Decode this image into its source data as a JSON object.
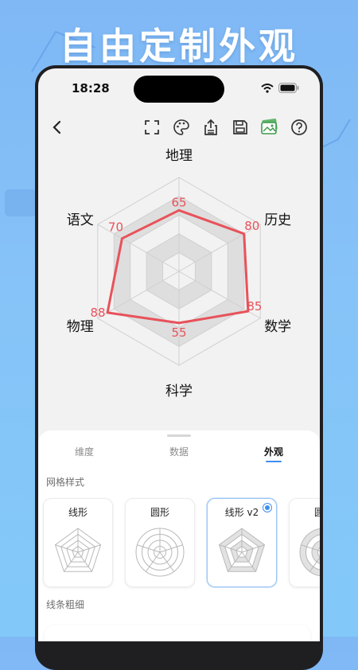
{
  "banner": {
    "title": "自由定制外观"
  },
  "status": {
    "time": "18:28"
  },
  "toolbar": {
    "icons": [
      "back-icon",
      "fullscreen-icon",
      "palette-icon",
      "export-icon",
      "save-icon",
      "image-icon",
      "help-icon"
    ]
  },
  "chart_data": {
    "type": "radar",
    "axes": [
      "地理",
      "历史",
      "数学",
      "科学",
      "物理",
      "语文"
    ],
    "values": [
      65,
      80,
      85,
      55,
      88,
      70
    ],
    "range": [
      0,
      100
    ],
    "series_color": "#e8525a"
  },
  "panel": {
    "tabs": [
      {
        "label": "维度"
      },
      {
        "label": "数据"
      },
      {
        "label": "外观"
      }
    ],
    "active_tab": "外观",
    "grid_style_title": "网格样式",
    "grid_styles": [
      {
        "label": "线形"
      },
      {
        "label": "圆形"
      },
      {
        "label": "线形 v2"
      },
      {
        "label": "圆形"
      }
    ],
    "selected_style": "线形 v2",
    "line_width_title": "线条粗细"
  },
  "colors": {
    "accent": "#3f8df0",
    "series": "#e8525a",
    "background": "#82c3f8"
  }
}
